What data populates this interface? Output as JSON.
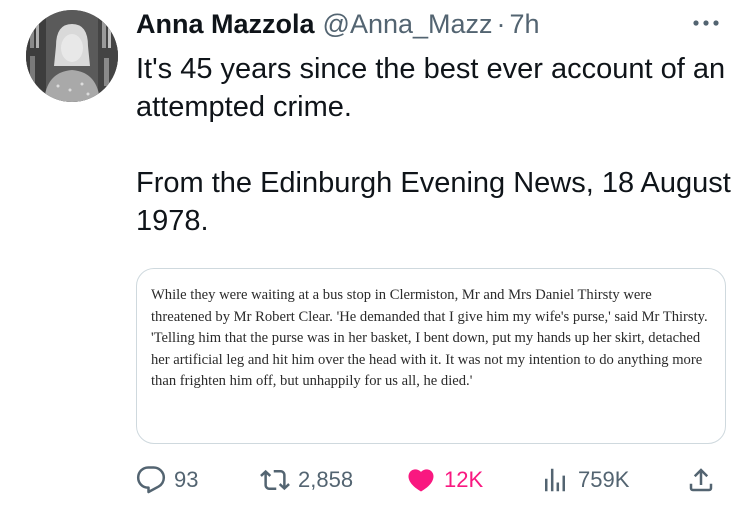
{
  "author": {
    "display_name": "Anna Mazzola",
    "handle": "@Anna_Mazz",
    "separator": "·",
    "time": "7h"
  },
  "tweet": {
    "line1": "It's 45 years since the best ever account of an attempted crime.",
    "line2": "From the Edinburgh Evening News, 18 August 1978."
  },
  "media": {
    "quote_text": "While they were waiting at a bus stop in Clermiston, Mr and Mrs Daniel Thirsty were threatened by Mr Robert Clear. 'He demanded that I give him my wife's purse,' said Mr Thirsty. 'Telling him that the purse was in her basket, I bent down, put my hands up her skirt, detached her artificial leg and hit him over the head with it. It was not my intention to do anything more than frighten him off, but unhappily for us all, he died.'"
  },
  "actions": {
    "replies": "93",
    "retweets": "2,858",
    "likes": "12K",
    "views": "759K"
  },
  "icons": {
    "more": "more-horizontal-icon",
    "reply": "reply-icon",
    "retweet": "retweet-icon",
    "like": "heart-filled-icon",
    "views": "views-bar-chart-icon",
    "share": "share-upload-icon"
  },
  "colors": {
    "text": "#0f1419",
    "secondary": "#536471",
    "like": "#f91880",
    "border": "#cfd9de"
  }
}
